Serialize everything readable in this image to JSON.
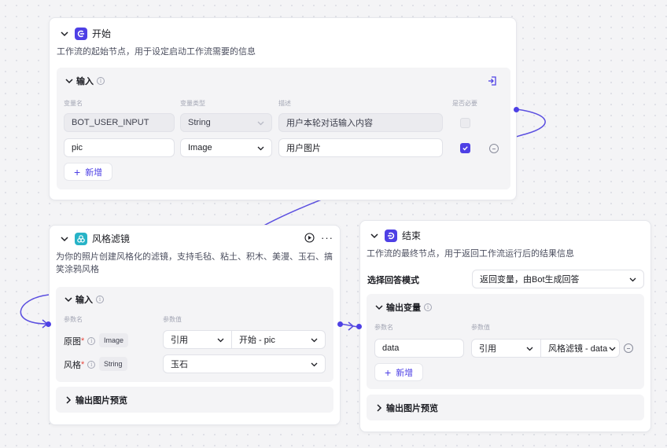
{
  "colors": {
    "accent": "#4e40e5",
    "edge": "#5b4fe0",
    "required": "#e5453b"
  },
  "start_node": {
    "title": "开始",
    "icon": "start-icon",
    "description": "工作流的起始节点，用于设定启动工作流需要的信息",
    "input_section": {
      "title": "输入",
      "columns": [
        "变量名",
        "变量类型",
        "描述",
        "是否必要"
      ],
      "rows": [
        {
          "name": "BOT_USER_INPUT",
          "type": "String",
          "desc": "用户本轮对话输入内容",
          "required": false,
          "locked": true
        },
        {
          "name": "pic",
          "type": "Image",
          "desc": "用户图片",
          "required": true,
          "locked": false
        }
      ],
      "add_label": "新增"
    }
  },
  "filter_node": {
    "title": "风格滤镜",
    "icon": "filter-plugin-icon",
    "description": "为你的照片创建风格化的滤镜，支持毛毡、粘土、积木、美漫、玉石、搞笑涂鸦风格",
    "input_section": {
      "title": "输入",
      "columns": [
        "参数名",
        "参数值"
      ],
      "rows": [
        {
          "name": "原图",
          "type": "Image",
          "mode": "引用",
          "value": "开始 - pic"
        },
        {
          "name": "风格",
          "type": "String",
          "value": "玉石"
        }
      ]
    },
    "output_preview": "输出图片预览"
  },
  "end_node": {
    "title": "结束",
    "icon": "end-icon",
    "description": "工作流的最终节点，用于返回工作流运行后的结果信息",
    "answer_mode_label": "选择回答模式",
    "answer_mode_value": "返回变量，由Bot生成回答",
    "output_section": {
      "title": "输出变量",
      "columns": [
        "参数名",
        "参数值"
      ],
      "rows": [
        {
          "name": "data",
          "mode": "引用",
          "value": "风格滤镜 - data"
        }
      ],
      "add_label": "新增"
    },
    "output_preview": "输出图片预览"
  }
}
